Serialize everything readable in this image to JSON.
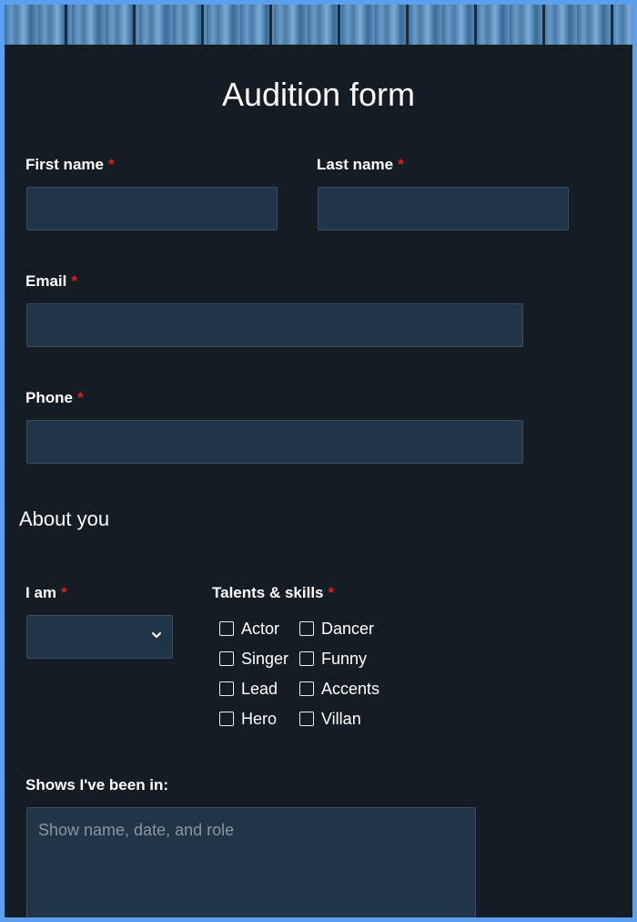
{
  "form": {
    "title": "Audition form",
    "required_marker": "*",
    "first_name": {
      "label": "First name",
      "value": ""
    },
    "last_name": {
      "label": "Last name",
      "value": ""
    },
    "email": {
      "label": "Email",
      "value": ""
    },
    "phone": {
      "label": "Phone",
      "value": ""
    },
    "about_section": {
      "title": "About you"
    },
    "i_am": {
      "label": "I am",
      "selected": ""
    },
    "talents": {
      "label": "Talents & skills",
      "options": [
        {
          "label": "Actor",
          "checked": false
        },
        {
          "label": "Dancer",
          "checked": false
        },
        {
          "label": "Singer",
          "checked": false
        },
        {
          "label": "Funny",
          "checked": false
        },
        {
          "label": "Lead",
          "checked": false
        },
        {
          "label": "Accents",
          "checked": false
        },
        {
          "label": "Hero",
          "checked": false
        },
        {
          "label": "Villan",
          "checked": false
        }
      ]
    },
    "shows": {
      "label": "Shows I've been in:",
      "placeholder": "Show name, date, and role"
    }
  },
  "icons": {
    "select_arrow": "chevron-down-icon",
    "banner": "wood-texture-banner"
  },
  "colors": {
    "page_border": "#5aa0ee",
    "background": "#141c24",
    "input_background": "#213549",
    "required": "#e01e1e",
    "text": "#ffffff",
    "placeholder": "#8b949e"
  }
}
